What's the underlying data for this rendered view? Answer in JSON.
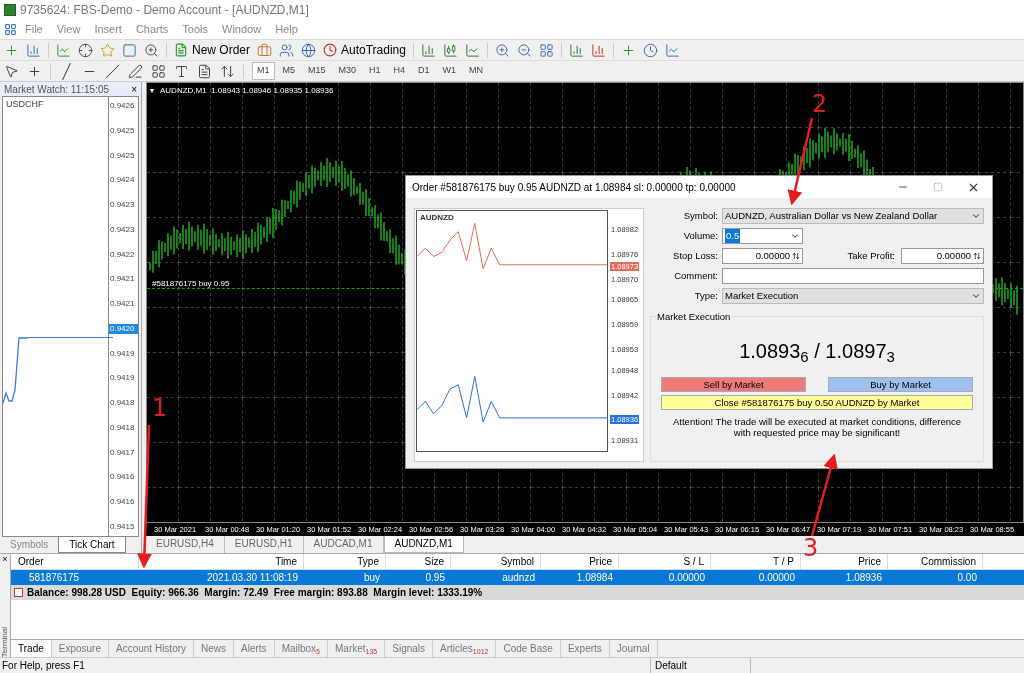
{
  "window": {
    "title": "9735624: FBS-Demo - Demo Account - [AUDNZD,M1]"
  },
  "menu": [
    "File",
    "View",
    "Insert",
    "Charts",
    "Tools",
    "Window",
    "Help"
  ],
  "toolbar": {
    "new_order": "New Order",
    "auto_trading": "AutoTrading"
  },
  "timeframes": [
    {
      "label": "M1",
      "selected": true
    },
    {
      "label": "M5",
      "selected": false
    },
    {
      "label": "M15",
      "selected": false
    },
    {
      "label": "M30",
      "selected": false
    },
    {
      "label": "H1",
      "selected": false
    },
    {
      "label": "H4",
      "selected": false
    },
    {
      "label": "D1",
      "selected": false
    },
    {
      "label": "W1",
      "selected": false
    },
    {
      "label": "MN",
      "selected": false
    }
  ],
  "market_watch": {
    "title": "Market Watch: 11:15:05",
    "close": "×",
    "symbol": "USDCHF",
    "price_labels": [
      {
        "text": "0.9426",
        "current": false
      },
      {
        "text": "0.9425",
        "current": false
      },
      {
        "text": "0.9425",
        "current": false
      },
      {
        "text": "0.9424",
        "current": false
      },
      {
        "text": "0.9423",
        "current": false
      },
      {
        "text": "0.9423",
        "current": false
      },
      {
        "text": "0.9422",
        "current": false
      },
      {
        "text": "0.9421",
        "current": false
      },
      {
        "text": "0.9421",
        "current": false
      },
      {
        "text": "0.9420",
        "current": true
      },
      {
        "text": "0.9419",
        "current": false
      },
      {
        "text": "0.9419",
        "current": false
      },
      {
        "text": "0.9418",
        "current": false
      },
      {
        "text": "0.9418",
        "current": false
      },
      {
        "text": "0.9417",
        "current": false
      },
      {
        "text": "0.9416",
        "current": false
      },
      {
        "text": "0.9416",
        "current": false
      },
      {
        "text": "0.9415",
        "current": false
      }
    ],
    "tabs": [
      {
        "label": "Symbols",
        "selected": false
      },
      {
        "label": "Tick Chart",
        "selected": true
      }
    ]
  },
  "chart": {
    "header_marker": "▾",
    "header": "AUDNZD,M1  1.08943 1.08946 1.08935 1.08936",
    "order_line_label": "#581876175 buy 0.95",
    "time_labels": [
      "30 Mar 2021",
      "30 Mar 00:48",
      "30 Mar 01:20",
      "30 Mar 01:52",
      "30 Mar 02:24",
      "30 Mar 02:56",
      "30 Mar 03:28",
      "30 Mar 04:00",
      "30 Mar 04:32",
      "30 Mar 05:04",
      "30 Mar 05:43",
      "30 Mar 06:15",
      "30 Mar 06:47",
      "30 Mar 07:19",
      "30 Mar 07:51",
      "30 Mar 08:23",
      "30 Mar 08:55"
    ],
    "tabs": [
      {
        "label": "EURUSD,H4",
        "selected": false
      },
      {
        "label": "EURUSD,H1",
        "selected": false
      },
      {
        "label": "AUDCAD,M1",
        "selected": false
      },
      {
        "label": "AUDNZD,M1",
        "selected": true
      }
    ]
  },
  "order_dialog": {
    "title": "Order #581876175 buy 0.95 AUDNZD at 1.08984 sl: 0.00000 tp: 0.00000",
    "mini_chart": {
      "symbol": "AUDNZD",
      "ask_label": "1.08973",
      "bid_label": "1.08936",
      "chart_data": {
        "type": "line",
        "ylim": [
          1.08928,
          1.08986
        ],
        "yticks": [
          {
            "value": 1.08982,
            "label": "1.08982"
          },
          {
            "value": 1.08976,
            "label": "1.08976"
          },
          {
            "value": 1.0897,
            "label": "1.08970"
          },
          {
            "value": 1.08965,
            "label": "1.08965"
          },
          {
            "value": 1.08959,
            "label": "1.08959"
          },
          {
            "value": 1.08953,
            "label": "1.08953"
          },
          {
            "value": 1.08948,
            "label": "1.08948"
          },
          {
            "value": 1.08942,
            "label": "1.08942"
          },
          {
            "value": 1.08931,
            "label": "1.08931"
          }
        ],
        "series": [
          {
            "color": "#e06a5a",
            "values": [
              1.08975,
              1.08977,
              1.08975,
              1.08976,
              1.08979,
              1.08981,
              1.08974,
              1.08983,
              1.08972,
              1.08977,
              1.08973,
              1.08973,
              1.08973,
              1.08973,
              1.08973,
              1.08973,
              1.08973,
              1.08973,
              1.08973,
              1.08973,
              1.08973,
              1.08973,
              1.08973,
              1.08973
            ]
          },
          {
            "color": "#2a6fdb",
            "values": [
              1.08938,
              1.0894,
              1.08937,
              1.08939,
              1.08943,
              1.08944,
              1.08936,
              1.08946,
              1.08935,
              1.0894,
              1.08936,
              1.08936,
              1.08936,
              1.08936,
              1.08936,
              1.08936,
              1.08936,
              1.08936,
              1.08936,
              1.08936,
              1.08936,
              1.08936,
              1.08936,
              1.08936
            ]
          }
        ]
      }
    },
    "symbol": {
      "label": "Symbol:",
      "value": "AUDNZD, Australian Dollar vs New Zealand Dollar"
    },
    "volume": {
      "label": "Volume:",
      "value": "0.5"
    },
    "stop_loss": {
      "label": "Stop Loss:",
      "value": "0.00000"
    },
    "take_profit": {
      "label": "Take Profit:",
      "value": "0.00000"
    },
    "comment": {
      "label": "Comment:"
    },
    "type": {
      "label": "Type:",
      "value": "Market Execution"
    },
    "group_title": "Market Execution",
    "quote": "1.0893$_{6}$ / 1.0897$_{3}$",
    "sell_button": "Sell by Market",
    "buy_button": "Buy by Market",
    "close_button": "Close #581876175 buy 0.50 AUDNZD by Market",
    "attention": "Attention! The trade will be executed at market conditions, difference with requested price may be significant!"
  },
  "terminal": {
    "side_label": "Terminal",
    "close": "×",
    "columns": [
      "Order",
      "Time",
      "Type",
      "Size",
      "Symbol",
      "Price",
      "S / L",
      "T / P",
      "Price",
      "Commission"
    ],
    "rows": [
      {
        "selected": true,
        "cells": [
          "581876175",
          "2021.03.30 11:08:19",
          "buy",
          "0.95",
          "audnzd",
          "1.08984",
          "0.00000",
          "0.00000",
          "1.08936",
          "0.00"
        ]
      }
    ],
    "summary": "Balance: 998.28 USD  Equity: 966.36  Margin: 72.49  Free margin: 893.88  Margin level: 1333.19%",
    "tabs": [
      {
        "label": "Trade",
        "selected": true
      },
      {
        "label": "Exposure",
        "selected": false
      },
      {
        "label": "Account History",
        "selected": false
      },
      {
        "label": "News",
        "selected": false
      },
      {
        "label": "Alerts",
        "selected": false
      },
      {
        "label": "Mailbox",
        "badge": "5",
        "selected": false
      },
      {
        "label": "Market",
        "badge": "135",
        "selected": false
      },
      {
        "label": "Signals",
        "selected": false
      },
      {
        "label": "Articles",
        "badge": "1012",
        "selected": false
      },
      {
        "label": "Code Base",
        "selected": false
      },
      {
        "label": "Experts",
        "selected": false
      },
      {
        "label": "Journal",
        "selected": false
      }
    ]
  },
  "status_bar": {
    "help": "For Help, press F1",
    "profile": "Default"
  },
  "annotations": [
    {
      "label": "1"
    },
    {
      "label": "2"
    },
    {
      "label": "3"
    }
  ]
}
